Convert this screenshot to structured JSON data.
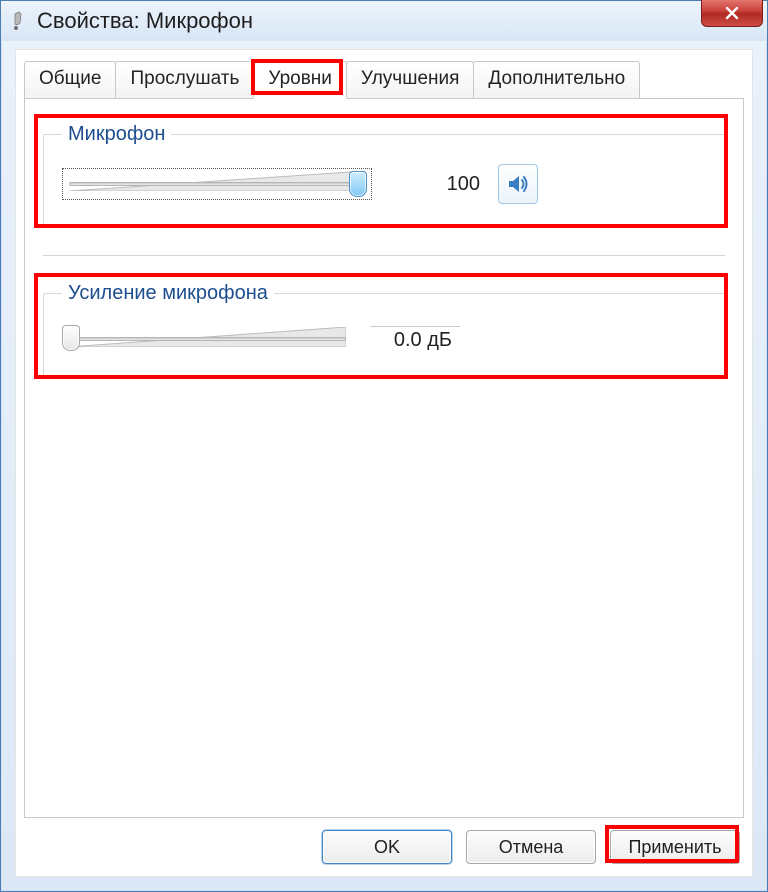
{
  "window": {
    "title": "Свойства: Микрофон"
  },
  "tabs": {
    "general": "Общие",
    "listen": "Прослушать",
    "levels": "Уровни",
    "enhancements": "Улучшения",
    "advanced": "Дополнительно",
    "active": "levels"
  },
  "mic_level": {
    "legend": "Микрофон",
    "value": "100",
    "slider_percent": 100
  },
  "mic_boost": {
    "legend": "Усиление микрофона",
    "value": "0.0 дБ",
    "slider_percent": 0
  },
  "buttons": {
    "ok": "OK",
    "cancel": "Отмена",
    "apply": "Применить"
  },
  "highlights": {
    "levels_tab": true,
    "mic_group": true,
    "boost_group": true,
    "apply_btn": true
  }
}
